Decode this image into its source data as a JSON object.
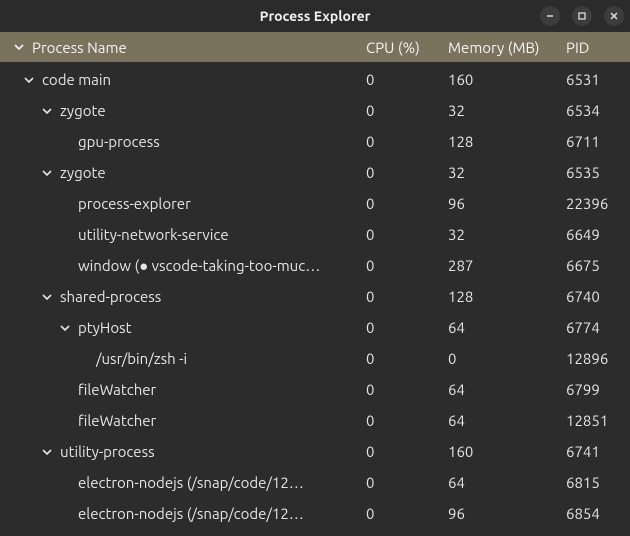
{
  "window": {
    "title": "Process Explorer"
  },
  "columns": {
    "name": "Process Name",
    "cpu": "CPU (%)",
    "memory": "Memory (MB)",
    "pid": "PID"
  },
  "rows": [
    {
      "indent": 0,
      "expandable": true,
      "name": "code main",
      "cpu": "0",
      "memory": "160",
      "pid": "6531"
    },
    {
      "indent": 1,
      "expandable": true,
      "name": "zygote",
      "cpu": "0",
      "memory": "32",
      "pid": "6534"
    },
    {
      "indent": 2,
      "expandable": false,
      "name": "gpu-process",
      "cpu": "0",
      "memory": "128",
      "pid": "6711"
    },
    {
      "indent": 1,
      "expandable": true,
      "name": "zygote",
      "cpu": "0",
      "memory": "32",
      "pid": "6535"
    },
    {
      "indent": 2,
      "expandable": false,
      "name": "process-explorer",
      "cpu": "0",
      "memory": "96",
      "pid": "22396"
    },
    {
      "indent": 2,
      "expandable": false,
      "name": "utility-network-service",
      "cpu": "0",
      "memory": "32",
      "pid": "6649"
    },
    {
      "indent": 2,
      "expandable": false,
      "name": "window (● vscode-taking-too-muc…",
      "cpu": "0",
      "memory": "287",
      "pid": "6675"
    },
    {
      "indent": 1,
      "expandable": true,
      "name": "shared-process",
      "cpu": "0",
      "memory": "128",
      "pid": "6740"
    },
    {
      "indent": 2,
      "expandable": true,
      "name": "ptyHost",
      "cpu": "0",
      "memory": "64",
      "pid": "6774"
    },
    {
      "indent": 3,
      "expandable": false,
      "name": "/usr/bin/zsh -i",
      "cpu": "0",
      "memory": "0",
      "pid": "12896"
    },
    {
      "indent": 2,
      "expandable": false,
      "name": "fileWatcher",
      "cpu": "0",
      "memory": "64",
      "pid": "6799"
    },
    {
      "indent": 2,
      "expandable": false,
      "name": "fileWatcher",
      "cpu": "0",
      "memory": "64",
      "pid": "12851"
    },
    {
      "indent": 1,
      "expandable": true,
      "name": "utility-process",
      "cpu": "0",
      "memory": "160",
      "pid": "6741"
    },
    {
      "indent": 2,
      "expandable": false,
      "name": "electron-nodejs (/snap/code/12…",
      "cpu": "0",
      "memory": "64",
      "pid": "6815"
    },
    {
      "indent": 2,
      "expandable": false,
      "name": "electron-nodejs (/snap/code/12…",
      "cpu": "0",
      "memory": "96",
      "pid": "6854"
    }
  ]
}
